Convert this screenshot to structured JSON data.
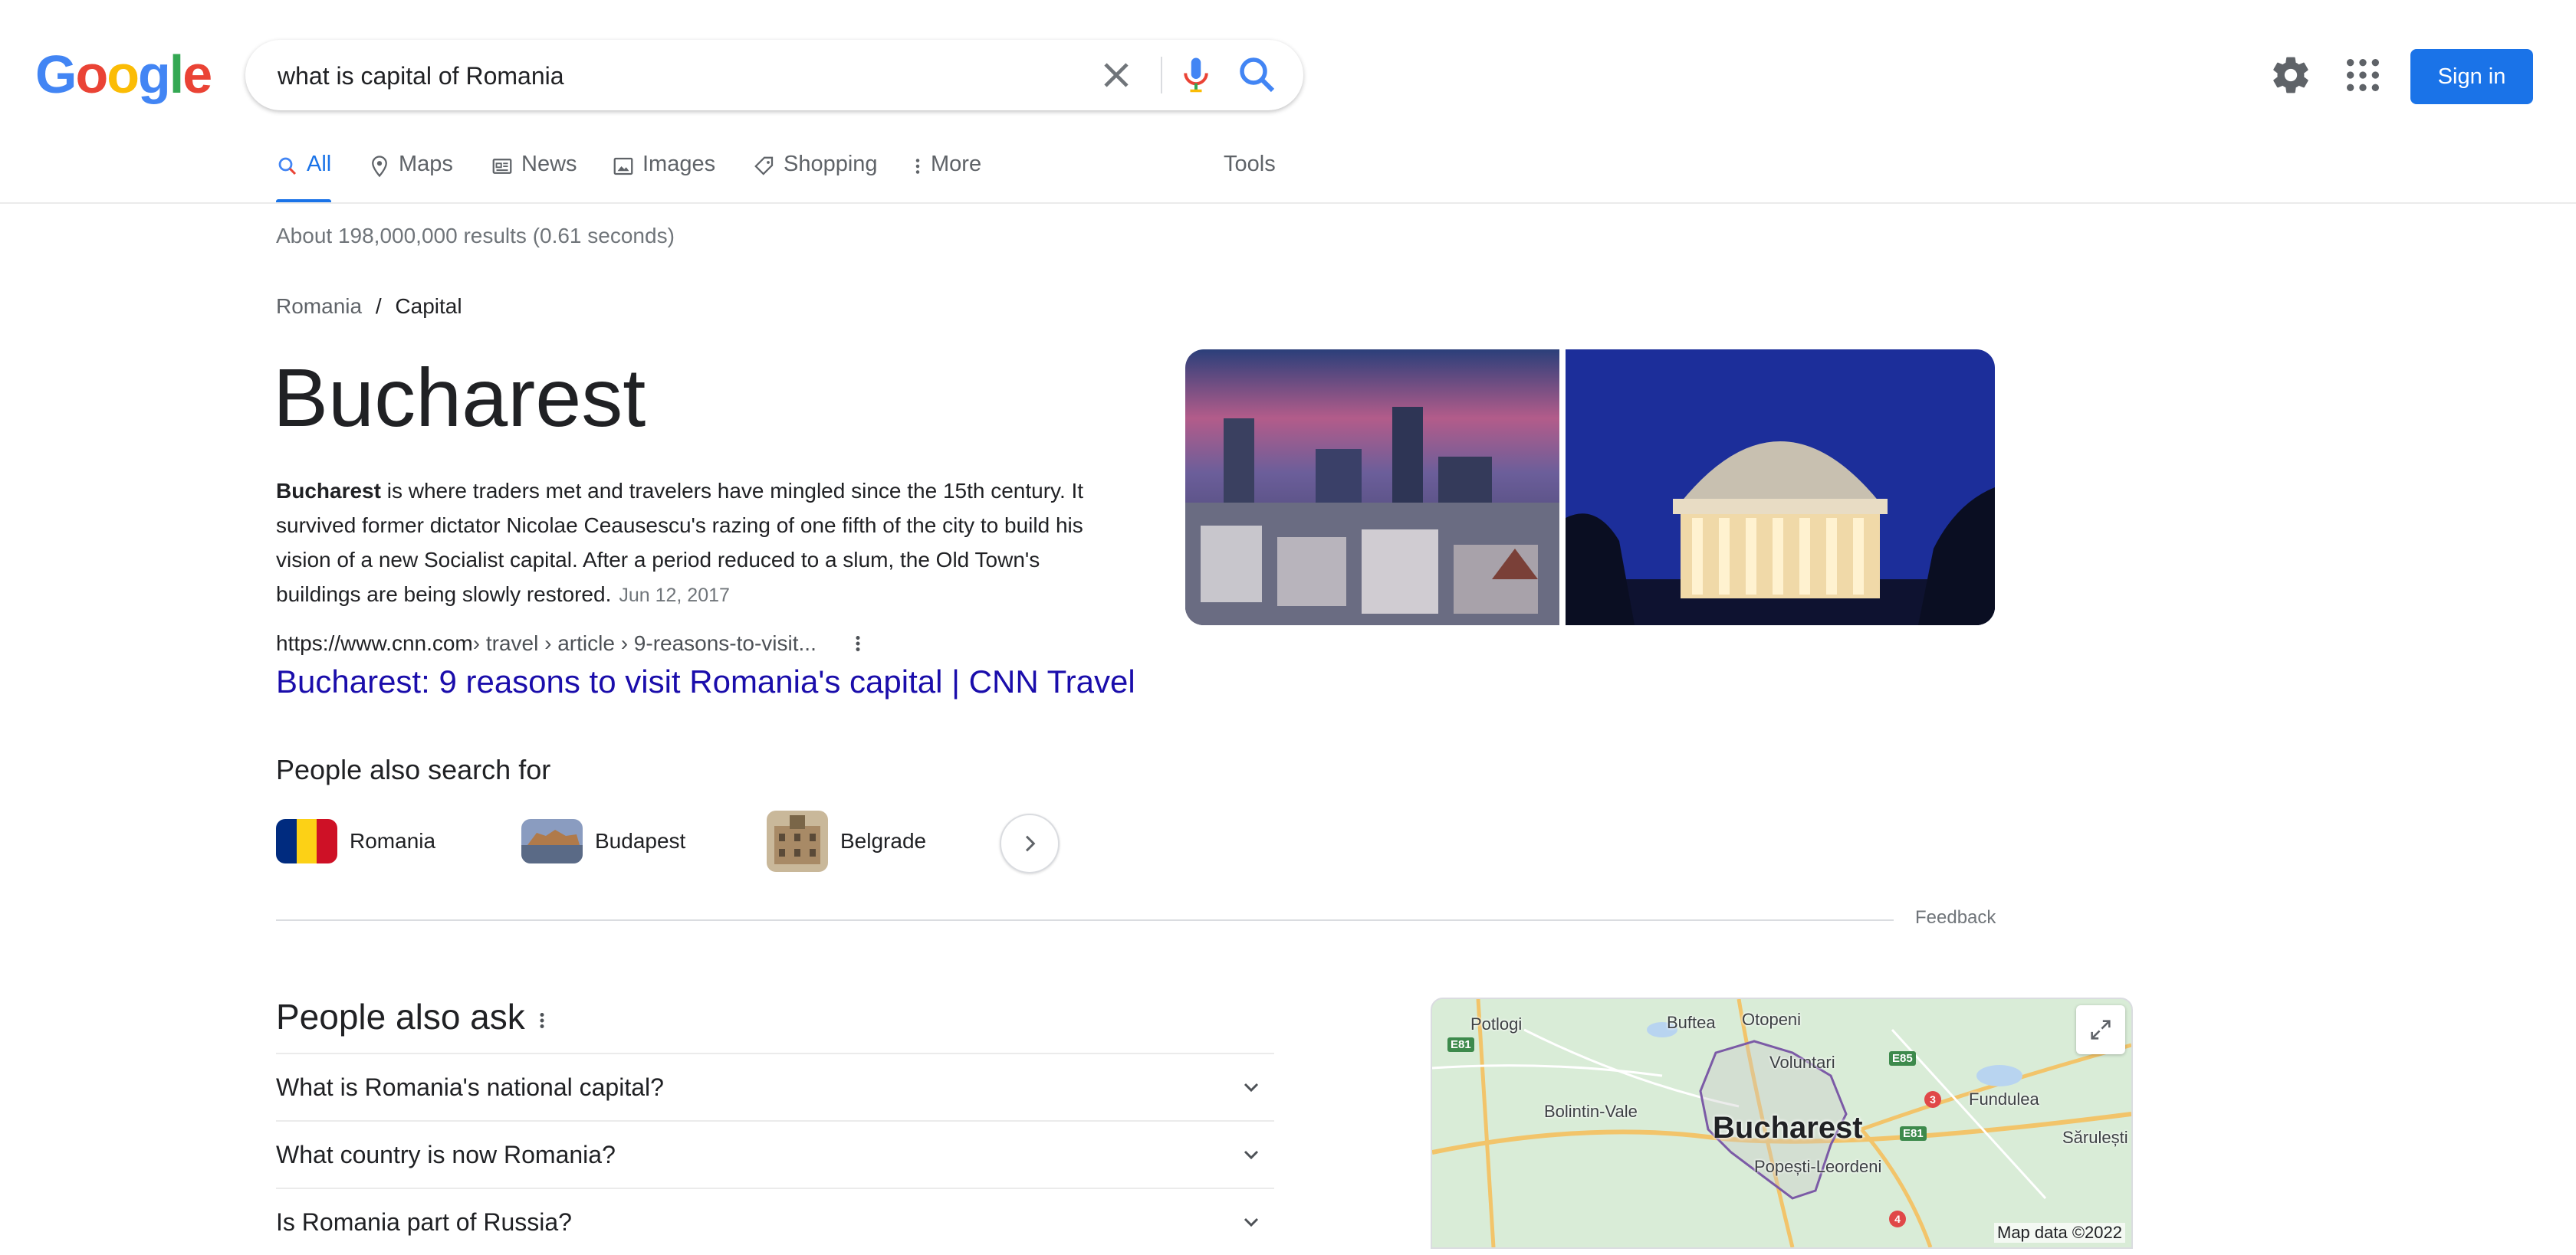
{
  "colors": {
    "accent": "#1a73e8",
    "link": "#1a0dab",
    "logo_blue": "#4285F4",
    "logo_red": "#EA4335",
    "logo_yellow": "#FBBC05",
    "logo_green": "#34A853"
  },
  "header": {
    "logo": [
      "G",
      "o",
      "o",
      "g",
      "l",
      "e"
    ],
    "search": {
      "value": "what is capital of Romania",
      "placeholder": ""
    },
    "sign_in_label": "Sign in"
  },
  "tabs": [
    {
      "label": "All",
      "icon": "search-icon",
      "active": true
    },
    {
      "label": "Maps",
      "icon": "pin-icon"
    },
    {
      "label": "News",
      "icon": "news-icon"
    },
    {
      "label": "Images",
      "icon": "image-icon"
    },
    {
      "label": "Shopping",
      "icon": "tag-icon"
    },
    {
      "label": "More",
      "icon": "more-vert-icon"
    }
  ],
  "tools_label": "Tools",
  "result_stats": "About 198,000,000 results (0.61 seconds)",
  "answer": {
    "breadcrumb": {
      "parent": "Romania",
      "separator": "/",
      "current": "Capital"
    },
    "title": "Bucharest",
    "snippet_bold": "Bucharest",
    "snippet_text": " is where traders met and travelers have mingled since the 15th century. It survived former dictator Nicolae Ceausescu's razing of one fifth of the city to build his vision of a new Socialist capital. After a period reduced to a slum, the Old Town's buildings are being slowly restored.",
    "snippet_date": "Jun 12, 2017",
    "source_domain": "https://www.cnn.com",
    "source_path": " › travel › article › 9-reasons-to-visit...",
    "link_title": "Bucharest: 9 reasons to visit Romania's capital | CNN Travel"
  },
  "people_also_search": {
    "title": "People also search for",
    "items": [
      {
        "label": "Romania"
      },
      {
        "label": "Budapest"
      },
      {
        "label": "Belgrade"
      }
    ]
  },
  "feedback_label": "Feedback",
  "people_also_ask": {
    "title": "People also ask",
    "questions": [
      "What is Romania's national capital?",
      "What country is now Romania?",
      "Is Romania part of Russia?"
    ]
  },
  "map": {
    "city": "Bucharest",
    "labels": [
      "Potlogi",
      "Buftea",
      "Otopeni",
      "Voluntari",
      "Bolintin-Vale",
      "Fundulea",
      "Sărulești",
      "Popești-Leordeni"
    ],
    "shields": [
      "E81",
      "E85",
      "E81"
    ],
    "routes": [
      "3",
      "4"
    ],
    "attribution": "Map data ©2022"
  }
}
